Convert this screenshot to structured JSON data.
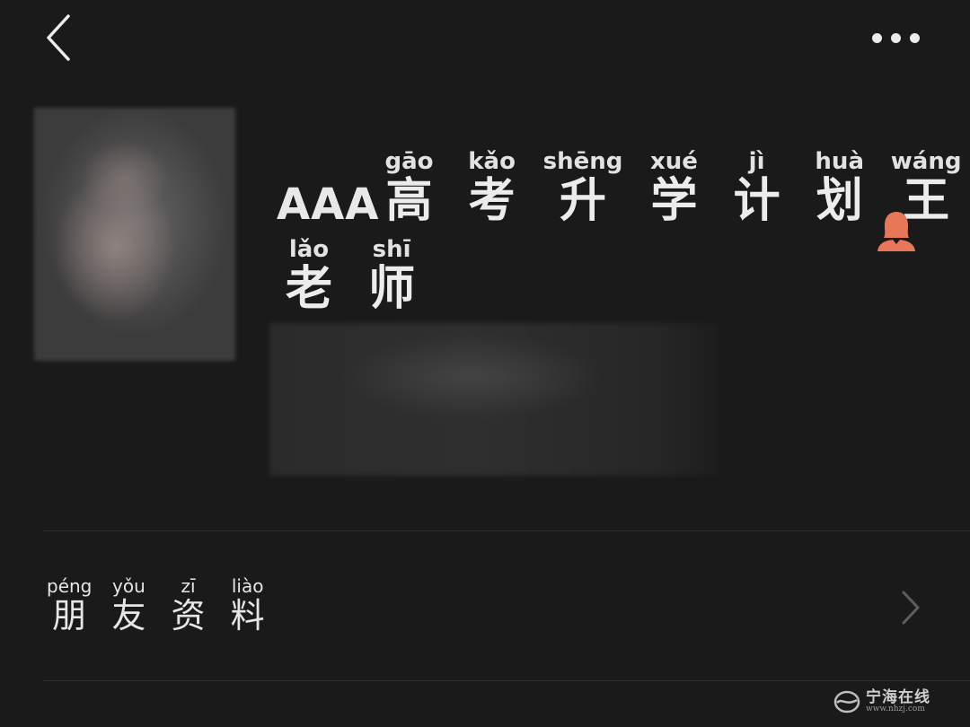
{
  "header": {
    "back_icon": "chevron-left-icon",
    "more_icon": "more-horizontal-icon"
  },
  "profile": {
    "name_prefix": "AAA",
    "name_line1": [
      {
        "char": "高",
        "pinyin": "gāo"
      },
      {
        "char": "考",
        "pinyin": "kǎo"
      },
      {
        "char": "升",
        "pinyin": "shēng"
      },
      {
        "char": "学",
        "pinyin": "xué"
      },
      {
        "char": "计",
        "pinyin": "jì"
      },
      {
        "char": "划",
        "pinyin": "huà"
      },
      {
        "char": "王",
        "pinyin": "wáng"
      }
    ],
    "name_line2": [
      {
        "char": "老",
        "pinyin": "lǎo"
      },
      {
        "char": "师",
        "pinyin": "shī"
      }
    ],
    "gender_icon": "female-user-icon",
    "gender_color": "#e8775a"
  },
  "friend_info": {
    "label": [
      {
        "char": "朋",
        "pinyin": "péng"
      },
      {
        "char": "友",
        "pinyin": "yǒu"
      },
      {
        "char": "资",
        "pinyin": "zī"
      },
      {
        "char": "料",
        "pinyin": "liào"
      }
    ],
    "chevron_icon": "chevron-right-icon"
  },
  "watermark": {
    "title": "宁海在线",
    "url": "www.nhzj.com"
  }
}
